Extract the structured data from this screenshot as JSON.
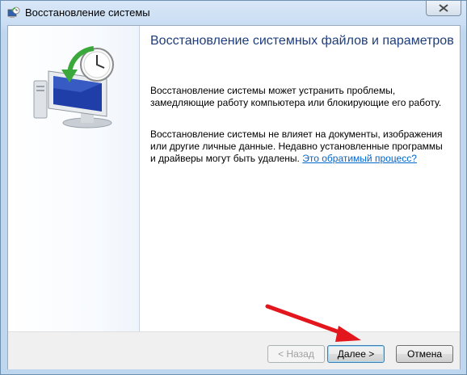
{
  "window": {
    "title": "Восстановление системы",
    "icon": "system-restore-icon"
  },
  "content": {
    "heading": "Восстановление системных файлов и параметров",
    "paragraph1": "Восстановление системы может устранить проблемы, замедляющие работу компьютера или блокирующие его работу.",
    "paragraph2": "Восстановление системы не влияет на документы, изображения или другие личные данные. Недавно установленные программы и драйверы могут быть удалены.",
    "link": "Это обратимый процесс?"
  },
  "buttons": {
    "back": "< Назад",
    "next": "Далее >",
    "cancel": "Отмена"
  },
  "annotation": {
    "arrow_color": "#e3161d"
  }
}
